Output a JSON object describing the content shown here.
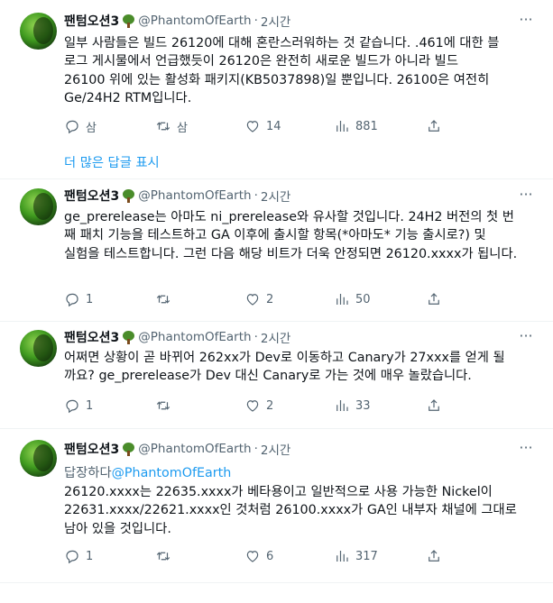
{
  "user": {
    "name": "팬텀오션3",
    "handle": "@PhantomOfEarth"
  },
  "more_glyph": "···",
  "separator": "·",
  "tweets": [
    {
      "time": "2시간",
      "lines": [
        "일부 사람들은 빌드 26120에 대해 혼란스러워하는 것 같습니다. .461에 대한 블",
        "로그 게시물에서 언급했듯이 26120은 완전히 새로운 빌드가 아니라 빌드",
        "26100 위에 있는 활성화 패키지(KB5037898)일 뿐입니다. 26100은 여전히",
        "Ge/24H2 RTM입니다."
      ],
      "reply_label": "삼",
      "retweet_label": "삼",
      "likes": "14",
      "views": "881"
    },
    {
      "time": "2시간",
      "lines": [
        "ge_prerelease는 아마도 ni_prerelease와 유사할 것입니다. 24H2 버전의 첫 번",
        "째 패치 기능을 테스트하고 GA 이후에 출시할 항목(*아마도* 기능 출시로?) 및",
        "실험을 테스트합니다. 그런 다음 해당 비트가 더욱 안정되면 26120.xxxx가 됩니다."
      ],
      "replies": "1",
      "likes": "2",
      "views": "50"
    },
    {
      "time": "2시간",
      "lines": [
        "어쩌면 상황이 곧 바뀌어 262xx가 Dev로 이동하고 Canary가 27xxx를 얻게 될",
        "까요? ge_prerelease가 Dev 대신 Canary로 가는 것에 매우 놀랐습니다."
      ],
      "replies": "1",
      "likes": "2",
      "views": "33"
    },
    {
      "time": "2시간",
      "reply_to_prefix": "답장하다",
      "reply_to_mention": "@PhantomOfEarth",
      "lines": [
        "26120.xxxx는 22635.xxxx가 베타용이고 일반적으로 사용 가능한 Nickel이",
        "22631.xxxx/22621.xxxx인 것처럼 26100.xxxx가 GA인 내부자 채널에 그대로",
        "남아 있을 것입니다."
      ],
      "replies": "1",
      "likes": "6",
      "views": "317"
    }
  ],
  "show_more_replies": "더 많은 답글 표시",
  "icons": {
    "reply": "reply-bubble-icon",
    "retweet": "retweet-arrows-icon",
    "like": "heart-icon",
    "views": "views-bar-chart-icon",
    "share": "share-upload-icon",
    "more": "more-dots-icon",
    "badge": "tree-emoji-icon"
  },
  "colors": {
    "text": "#0f1419",
    "secondary": "#536471",
    "link": "#1d9bf0",
    "divider": "#eff3f4"
  }
}
